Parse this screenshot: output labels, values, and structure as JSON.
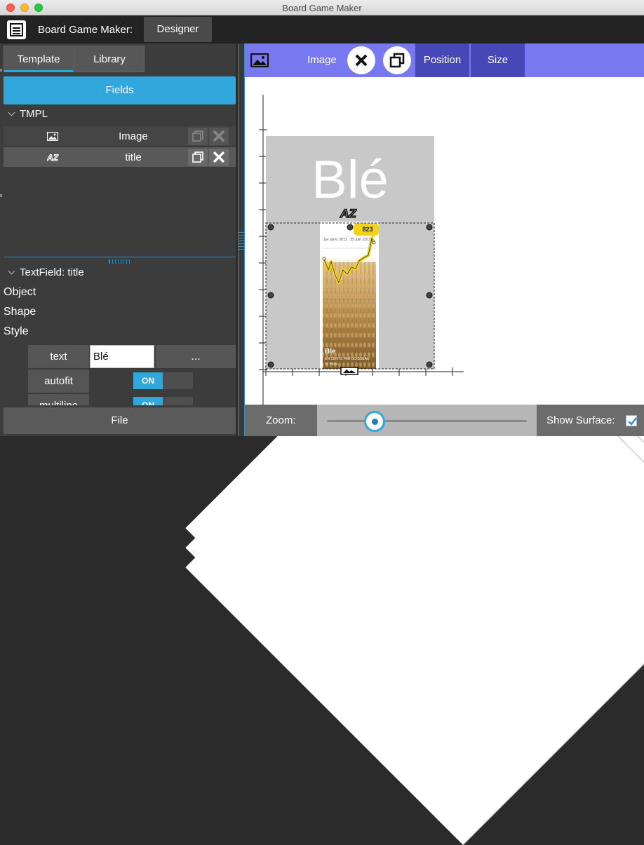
{
  "window": {
    "title": "Board Game Maker"
  },
  "appbar": {
    "name": "Board Game Maker:",
    "mode_button": "Designer"
  },
  "tabs": [
    {
      "label": "Template"
    },
    {
      "label": "Library"
    }
  ],
  "fields_button": "Fields",
  "tree": {
    "root": "TMPL",
    "items": [
      {
        "label": "Image",
        "icon": "image-icon"
      },
      {
        "label": "title",
        "icon": "text-az-icon"
      }
    ]
  },
  "properties": {
    "header": "TextField: title",
    "groups": [
      {
        "label": "Object"
      },
      {
        "label": "Shape"
      },
      {
        "label": "Style"
      }
    ],
    "text": {
      "label": "text",
      "value": "Blé",
      "more": "..."
    },
    "autofit": {
      "label": "autofit",
      "state": "ON"
    },
    "multiline": {
      "label": "multiline",
      "state": "ON"
    }
  },
  "file_button": "File",
  "toolbar": {
    "label": "Image",
    "position": "Position",
    "size": "Size"
  },
  "canvas": {
    "card_title": "Blé",
    "chart_badge": "823",
    "chart_date_left": "1er janv. 2011",
    "chart_date_right": "25 juin 2011",
    "card_caption": "Ble",
    "card_subcaption": "EN CENTS PAR BOISSEAU",
    "card_small": "AT Press"
  },
  "bottombar": {
    "zoom_label": "Zoom:",
    "zoom_level": 0.24,
    "show_surface_label": "Show Surface:",
    "show_surface_checked": true
  },
  "colors": {
    "accent_blue": "#32a7db",
    "toolbar_purple": "#7878f0",
    "toolbar_button": "#4747b8",
    "chart_yellow": "#f2d21b"
  }
}
